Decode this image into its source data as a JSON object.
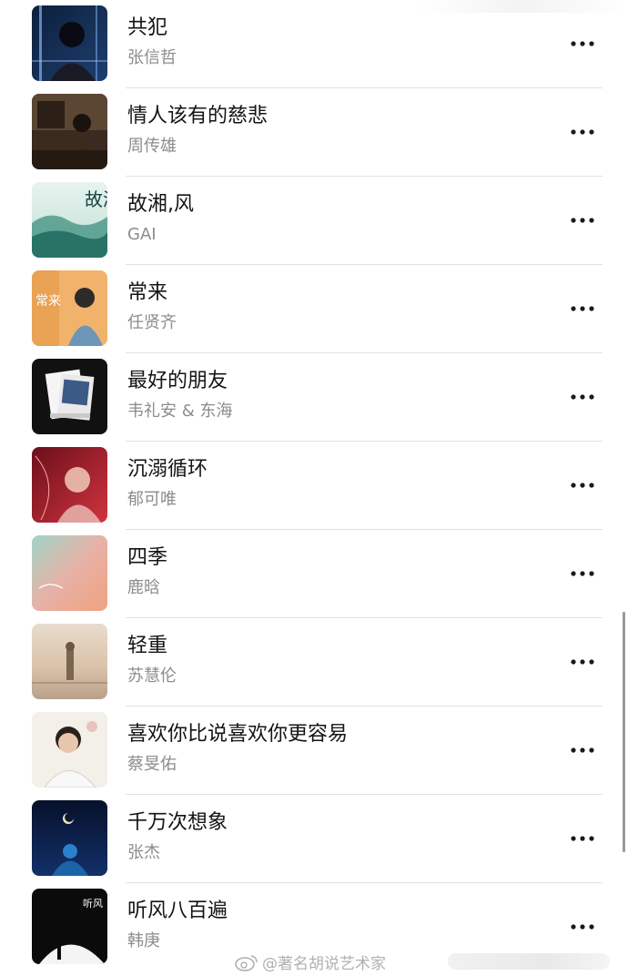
{
  "songs": [
    {
      "title": "共犯",
      "artist": "张信哲",
      "cover": "cover-gongfan"
    },
    {
      "title": "情人该有的慈悲",
      "artist": "周传雄",
      "cover": "cover-qingren"
    },
    {
      "title": "故湘,风",
      "artist": "GAI",
      "cover": "cover-guxiang",
      "cover_text": "故湘风"
    },
    {
      "title": "常来",
      "artist": "任贤齐",
      "cover": "cover-changlai",
      "cover_text": "常来"
    },
    {
      "title": "最好的朋友",
      "artist": "韦礼安 & 东海",
      "cover": "cover-zuihao"
    },
    {
      "title": "沉溺循环",
      "artist": "郁可唯",
      "cover": "cover-chenni"
    },
    {
      "title": "四季",
      "artist": "鹿晗",
      "cover": "cover-siji"
    },
    {
      "title": "轻重",
      "artist": "苏慧伦",
      "cover": "cover-qingzhong"
    },
    {
      "title": "喜欢你比说喜欢你更容易",
      "artist": "蔡旻佑",
      "cover": "cover-xihuan"
    },
    {
      "title": "千万次想象",
      "artist": "张杰",
      "cover": "cover-qianwan"
    },
    {
      "title": "听风八百遍",
      "artist": "韩庚",
      "cover": "cover-tingfeng",
      "cover_text": "听风"
    }
  ],
  "more_icon": "more-horizontal-icon",
  "watermark": {
    "text": "@著名胡说艺术家",
    "icon": "weibo-icon"
  },
  "colors": {
    "title": "#141414",
    "artist": "#8c8c8c",
    "divider": "#e2e2e2",
    "background": "#ffffff"
  }
}
